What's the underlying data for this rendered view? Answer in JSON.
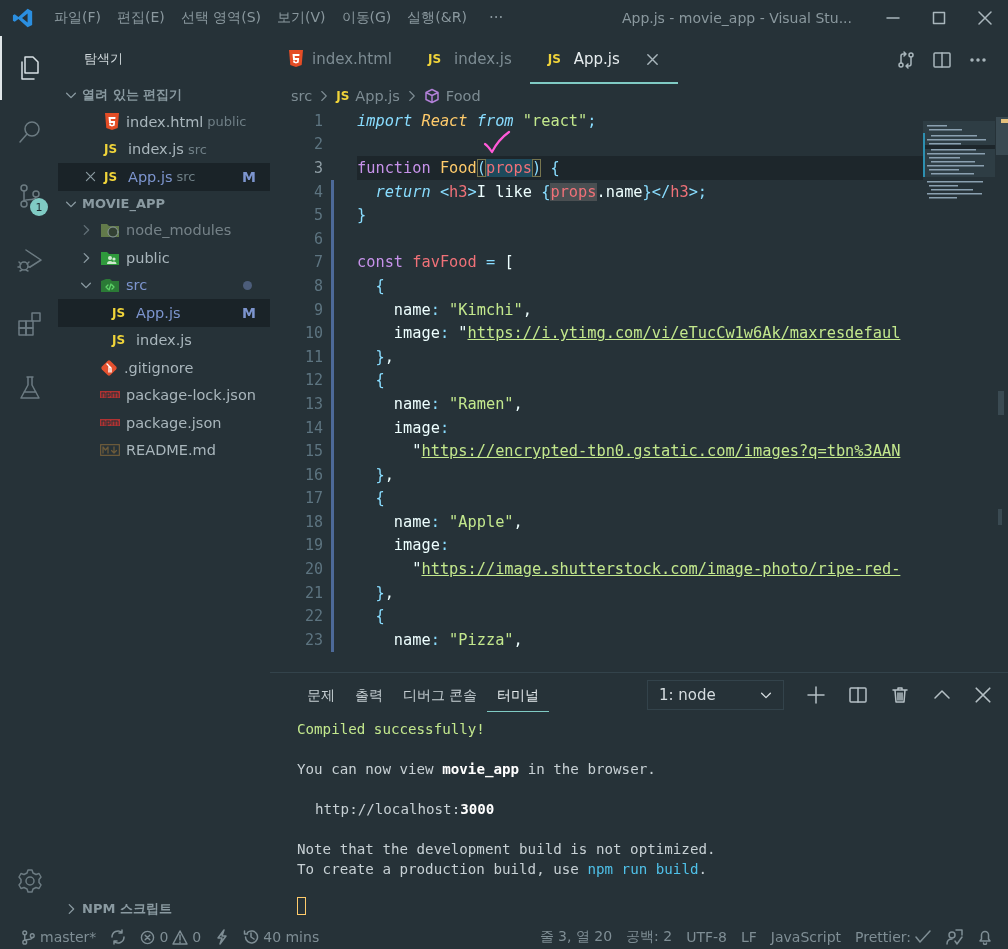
{
  "title_bar": {
    "menu": [
      "파일(F)",
      "편집(E)",
      "선택 영역(S)",
      "보기(V)",
      "이동(G)",
      "실행(&R)"
    ],
    "more": "···",
    "title": "App.js - movie_app - Visual Stu..."
  },
  "activity_bar": {
    "items": [
      {
        "kind": "files",
        "selected": true
      },
      {
        "kind": "search",
        "selected": false
      },
      {
        "kind": "source-control",
        "selected": false,
        "badge": "1"
      },
      {
        "kind": "debug",
        "selected": false
      },
      {
        "kind": "extensions",
        "selected": false
      },
      {
        "kind": "testing",
        "selected": false
      }
    ],
    "bottom": [
      {
        "kind": "settings",
        "selected": false
      }
    ]
  },
  "sidebar": {
    "title": "탐색기",
    "open_editors": {
      "label": "열려 있는 편집기",
      "expanded": true,
      "items": [
        {
          "name": "index.html",
          "folder": "public",
          "kind": "html",
          "selected": false,
          "modified": false
        },
        {
          "name": "index.js",
          "folder": "src",
          "kind": "js",
          "icon_label": "JS",
          "selected": false,
          "modified": false
        },
        {
          "name": "App.js",
          "folder": "src",
          "kind": "js",
          "icon_label": "JS",
          "selected": true,
          "modified": true,
          "badge": "M"
        }
      ]
    },
    "project": {
      "label": "MOVIE_APP",
      "expanded": true,
      "tree": [
        {
          "name": "node_modules",
          "kind": "node-folder",
          "expanded": false,
          "selected": false,
          "modified": false,
          "ignored": true
        },
        {
          "name": "public",
          "kind": "public-folder",
          "expanded": false,
          "selected": false,
          "modified": false,
          "ignored": false
        },
        {
          "name": "src",
          "kind": "src-folder",
          "expanded": true,
          "selected": false,
          "modified": true,
          "ignored": false,
          "children": [
            {
              "name": "App.js",
              "kind": "js",
              "icon_label": "JS",
              "selected": true,
              "modified": true,
              "ignored": false,
              "badge": "M"
            },
            {
              "name": "index.js",
              "kind": "js",
              "icon_label": "JS",
              "selected": false,
              "modified": false,
              "ignored": false
            }
          ]
        },
        {
          "name": ".gitignore",
          "kind": "git",
          "selected": false,
          "modified": false,
          "ignored": false
        },
        {
          "name": "package-lock.json",
          "kind": "npm",
          "selected": false,
          "modified": false,
          "ignored": false
        },
        {
          "name": "package.json",
          "kind": "npm",
          "selected": false,
          "modified": false,
          "ignored": false
        },
        {
          "name": "README.md",
          "kind": "md",
          "selected": false,
          "modified": false,
          "ignored": false
        }
      ]
    },
    "npm_scripts": {
      "label": "NPM 스크립트",
      "expanded": false
    }
  },
  "editor": {
    "tabs": [
      {
        "label": "index.html",
        "kind": "html",
        "selected": false
      },
      {
        "label": "index.js",
        "kind": "js",
        "icon_label": "JS",
        "selected": false
      },
      {
        "label": "App.js",
        "kind": "js",
        "icon_label": "JS",
        "selected": true
      }
    ],
    "breadcrumb": [
      {
        "kind": "folder",
        "label": "src"
      },
      {
        "kind": "file",
        "icon_label": "JS",
        "label": "App.js"
      },
      {
        "kind": "symbol",
        "label": "Food"
      }
    ],
    "lines": [
      {
        "n": "1",
        "current": false,
        "modified": false,
        "tokens": [
          {
            "text": "import ",
            "kind": "kwi"
          },
          {
            "text": "React ",
            "kind": "cls"
          },
          {
            "text": "from ",
            "kind": "kwi"
          },
          {
            "text": "\"react\"",
            "kind": "str"
          },
          {
            "text": ";",
            "kind": "p"
          }
        ]
      },
      {
        "n": "2",
        "current": false,
        "modified": false
      },
      {
        "n": "3",
        "current": true,
        "modified": false,
        "tokens": [
          {
            "text": "function ",
            "kind": "kw"
          },
          {
            "text": "Food",
            "kind": "fn"
          },
          {
            "text": "(",
            "kind": "bm"
          },
          {
            "text": "props",
            "kind": "sel"
          },
          {
            "text": ")",
            "kind": "bm"
          },
          {
            "text": " {",
            "kind": "p"
          }
        ]
      },
      {
        "n": "4",
        "current": false,
        "modified": true,
        "tokens": [
          {
            "text": "  return ",
            "kind": "kwi"
          },
          {
            "text": "<",
            "kind": "p"
          },
          {
            "text": "h3",
            "kind": "tag"
          },
          {
            "text": ">",
            "kind": "p"
          },
          {
            "text": "I like ",
            "kind": "t"
          },
          {
            "text": "{",
            "kind": "p"
          },
          {
            "text": "props",
            "kind": "ref"
          },
          {
            "text": ".name",
            "kind": "t"
          },
          {
            "text": "}",
            "kind": "p"
          },
          {
            "text": "</",
            "kind": "p"
          },
          {
            "text": "h3",
            "kind": "tag"
          },
          {
            "text": ">;",
            "kind": "p"
          }
        ]
      },
      {
        "n": "5",
        "current": false,
        "modified": true,
        "tokens": [
          {
            "text": "}",
            "kind": "p"
          }
        ]
      },
      {
        "n": "6",
        "current": false,
        "modified": true
      },
      {
        "n": "7",
        "current": false,
        "modified": true,
        "tokens": [
          {
            "text": "const ",
            "kind": "kw"
          },
          {
            "text": "favFood ",
            "kind": "var"
          },
          {
            "text": "= ",
            "kind": "p"
          },
          {
            "text": "[",
            "kind": "t"
          }
        ]
      },
      {
        "n": "8",
        "current": false,
        "modified": true,
        "tokens": [
          {
            "text": "  {",
            "kind": "p"
          }
        ]
      },
      {
        "n": "9",
        "current": false,
        "modified": true,
        "tokens": [
          {
            "text": "    name",
            "kind": "t"
          },
          {
            "text": ": ",
            "kind": "p"
          },
          {
            "text": "\"Kimchi\"",
            "kind": "str"
          },
          {
            "text": ",",
            "kind": "t"
          }
        ]
      },
      {
        "n": "10",
        "current": false,
        "modified": true,
        "tokens": [
          {
            "text": "    image",
            "kind": "t"
          },
          {
            "text": ": ",
            "kind": "p"
          },
          {
            "text": "\"",
            "kind": "t"
          },
          {
            "text": "https://i.ytimg.com/vi/eTucCw1w6Ak/maxresdefaul",
            "kind": "link"
          }
        ]
      },
      {
        "n": "11",
        "current": false,
        "modified": true,
        "tokens": [
          {
            "text": "  }",
            "kind": "p"
          },
          {
            "text": ",",
            "kind": "t"
          }
        ]
      },
      {
        "n": "12",
        "current": false,
        "modified": true,
        "tokens": [
          {
            "text": "  {",
            "kind": "p"
          }
        ]
      },
      {
        "n": "13",
        "current": false,
        "modified": true,
        "tokens": [
          {
            "text": "    name",
            "kind": "t"
          },
          {
            "text": ": ",
            "kind": "p"
          },
          {
            "text": "\"Ramen\"",
            "kind": "str"
          },
          {
            "text": ",",
            "kind": "t"
          }
        ]
      },
      {
        "n": "14",
        "current": false,
        "modified": true,
        "tokens": [
          {
            "text": "    image",
            "kind": "t"
          },
          {
            "text": ":",
            "kind": "p"
          }
        ]
      },
      {
        "n": "15",
        "current": false,
        "modified": true,
        "tokens": [
          {
            "text": "      \"",
            "kind": "t"
          },
          {
            "text": "https://encrypted-tbn0.gstatic.com/images?q=tbn%3AAN",
            "kind": "link"
          }
        ]
      },
      {
        "n": "16",
        "current": false,
        "modified": true,
        "tokens": [
          {
            "text": "  }",
            "kind": "p"
          },
          {
            "text": ",",
            "kind": "t"
          }
        ]
      },
      {
        "n": "17",
        "current": false,
        "modified": true,
        "tokens": [
          {
            "text": "  {",
            "kind": "p"
          }
        ]
      },
      {
        "n": "18",
        "current": false,
        "modified": true,
        "tokens": [
          {
            "text": "    name",
            "kind": "t"
          },
          {
            "text": ": ",
            "kind": "p"
          },
          {
            "text": "\"Apple\"",
            "kind": "str"
          },
          {
            "text": ",",
            "kind": "t"
          }
        ]
      },
      {
        "n": "19",
        "current": false,
        "modified": true,
        "tokens": [
          {
            "text": "    image",
            "kind": "t"
          },
          {
            "text": ":",
            "kind": "p"
          }
        ]
      },
      {
        "n": "20",
        "current": false,
        "modified": true,
        "tokens": [
          {
            "text": "      \"",
            "kind": "t"
          },
          {
            "text": "https://image.shutterstock.com/image-photo/ripe-red-",
            "kind": "link"
          }
        ]
      },
      {
        "n": "21",
        "current": false,
        "modified": true,
        "tokens": [
          {
            "text": "  }",
            "kind": "p"
          },
          {
            "text": ",",
            "kind": "t"
          }
        ]
      },
      {
        "n": "22",
        "current": false,
        "modified": true,
        "tokens": [
          {
            "text": "  {",
            "kind": "p"
          }
        ]
      },
      {
        "n": "23",
        "current": false,
        "modified": true,
        "tokens": [
          {
            "text": "    name",
            "kind": "t"
          },
          {
            "text": ": ",
            "kind": "p"
          },
          {
            "text": "\"Pizza\"",
            "kind": "str"
          },
          {
            "text": ",",
            "kind": "t"
          }
        ]
      }
    ]
  },
  "panel": {
    "tabs": [
      {
        "label": "문제",
        "selected": false
      },
      {
        "label": "출력",
        "selected": false
      },
      {
        "label": "디버그 콘솔",
        "selected": false
      },
      {
        "label": "터미널",
        "selected": true
      }
    ],
    "terminal_select": "1: node",
    "terminal": {
      "blocks": [
        {
          "lines": [
            {
              "indented": false,
              "segments": [
                {
                  "text": "Compiled successfully!",
                  "kind": "ok"
                }
              ]
            }
          ]
        },
        {
          "lines": [
            {
              "indented": false,
              "segments": [
                {
                  "text": "You can now view **movie_app** in the browser.",
                  "kind": "plain"
                }
              ]
            }
          ]
        },
        {
          "lines": [
            {
              "indented": true,
              "segments": [
                {
                  "text": "http://localhost:**3000**",
                  "kind": "plain"
                }
              ]
            }
          ]
        },
        {
          "lines": [
            {
              "indented": false,
              "segments": [
                {
                  "text": "Note that the development build is not optimized.",
                  "kind": "plain"
                }
              ]
            },
            {
              "indented": false,
              "segments": [
                {
                  "text": "To create a production build, use ",
                  "kind": "plain"
                },
                {
                  "text": "npm run build",
                  "kind": "cmd"
                },
                {
                  "text": ".",
                  "kind": "plain"
                }
              ]
            }
          ]
        }
      ]
    }
  },
  "status_bar": {
    "branch": "master*",
    "errors": "0",
    "warnings": "0",
    "history": "40 mins",
    "position": "줄 3, 열 20",
    "indent": "공백: 2",
    "encoding": "UTF-8",
    "eol": "LF",
    "language": "JavaScript",
    "formatter": "Prettier:"
  }
}
